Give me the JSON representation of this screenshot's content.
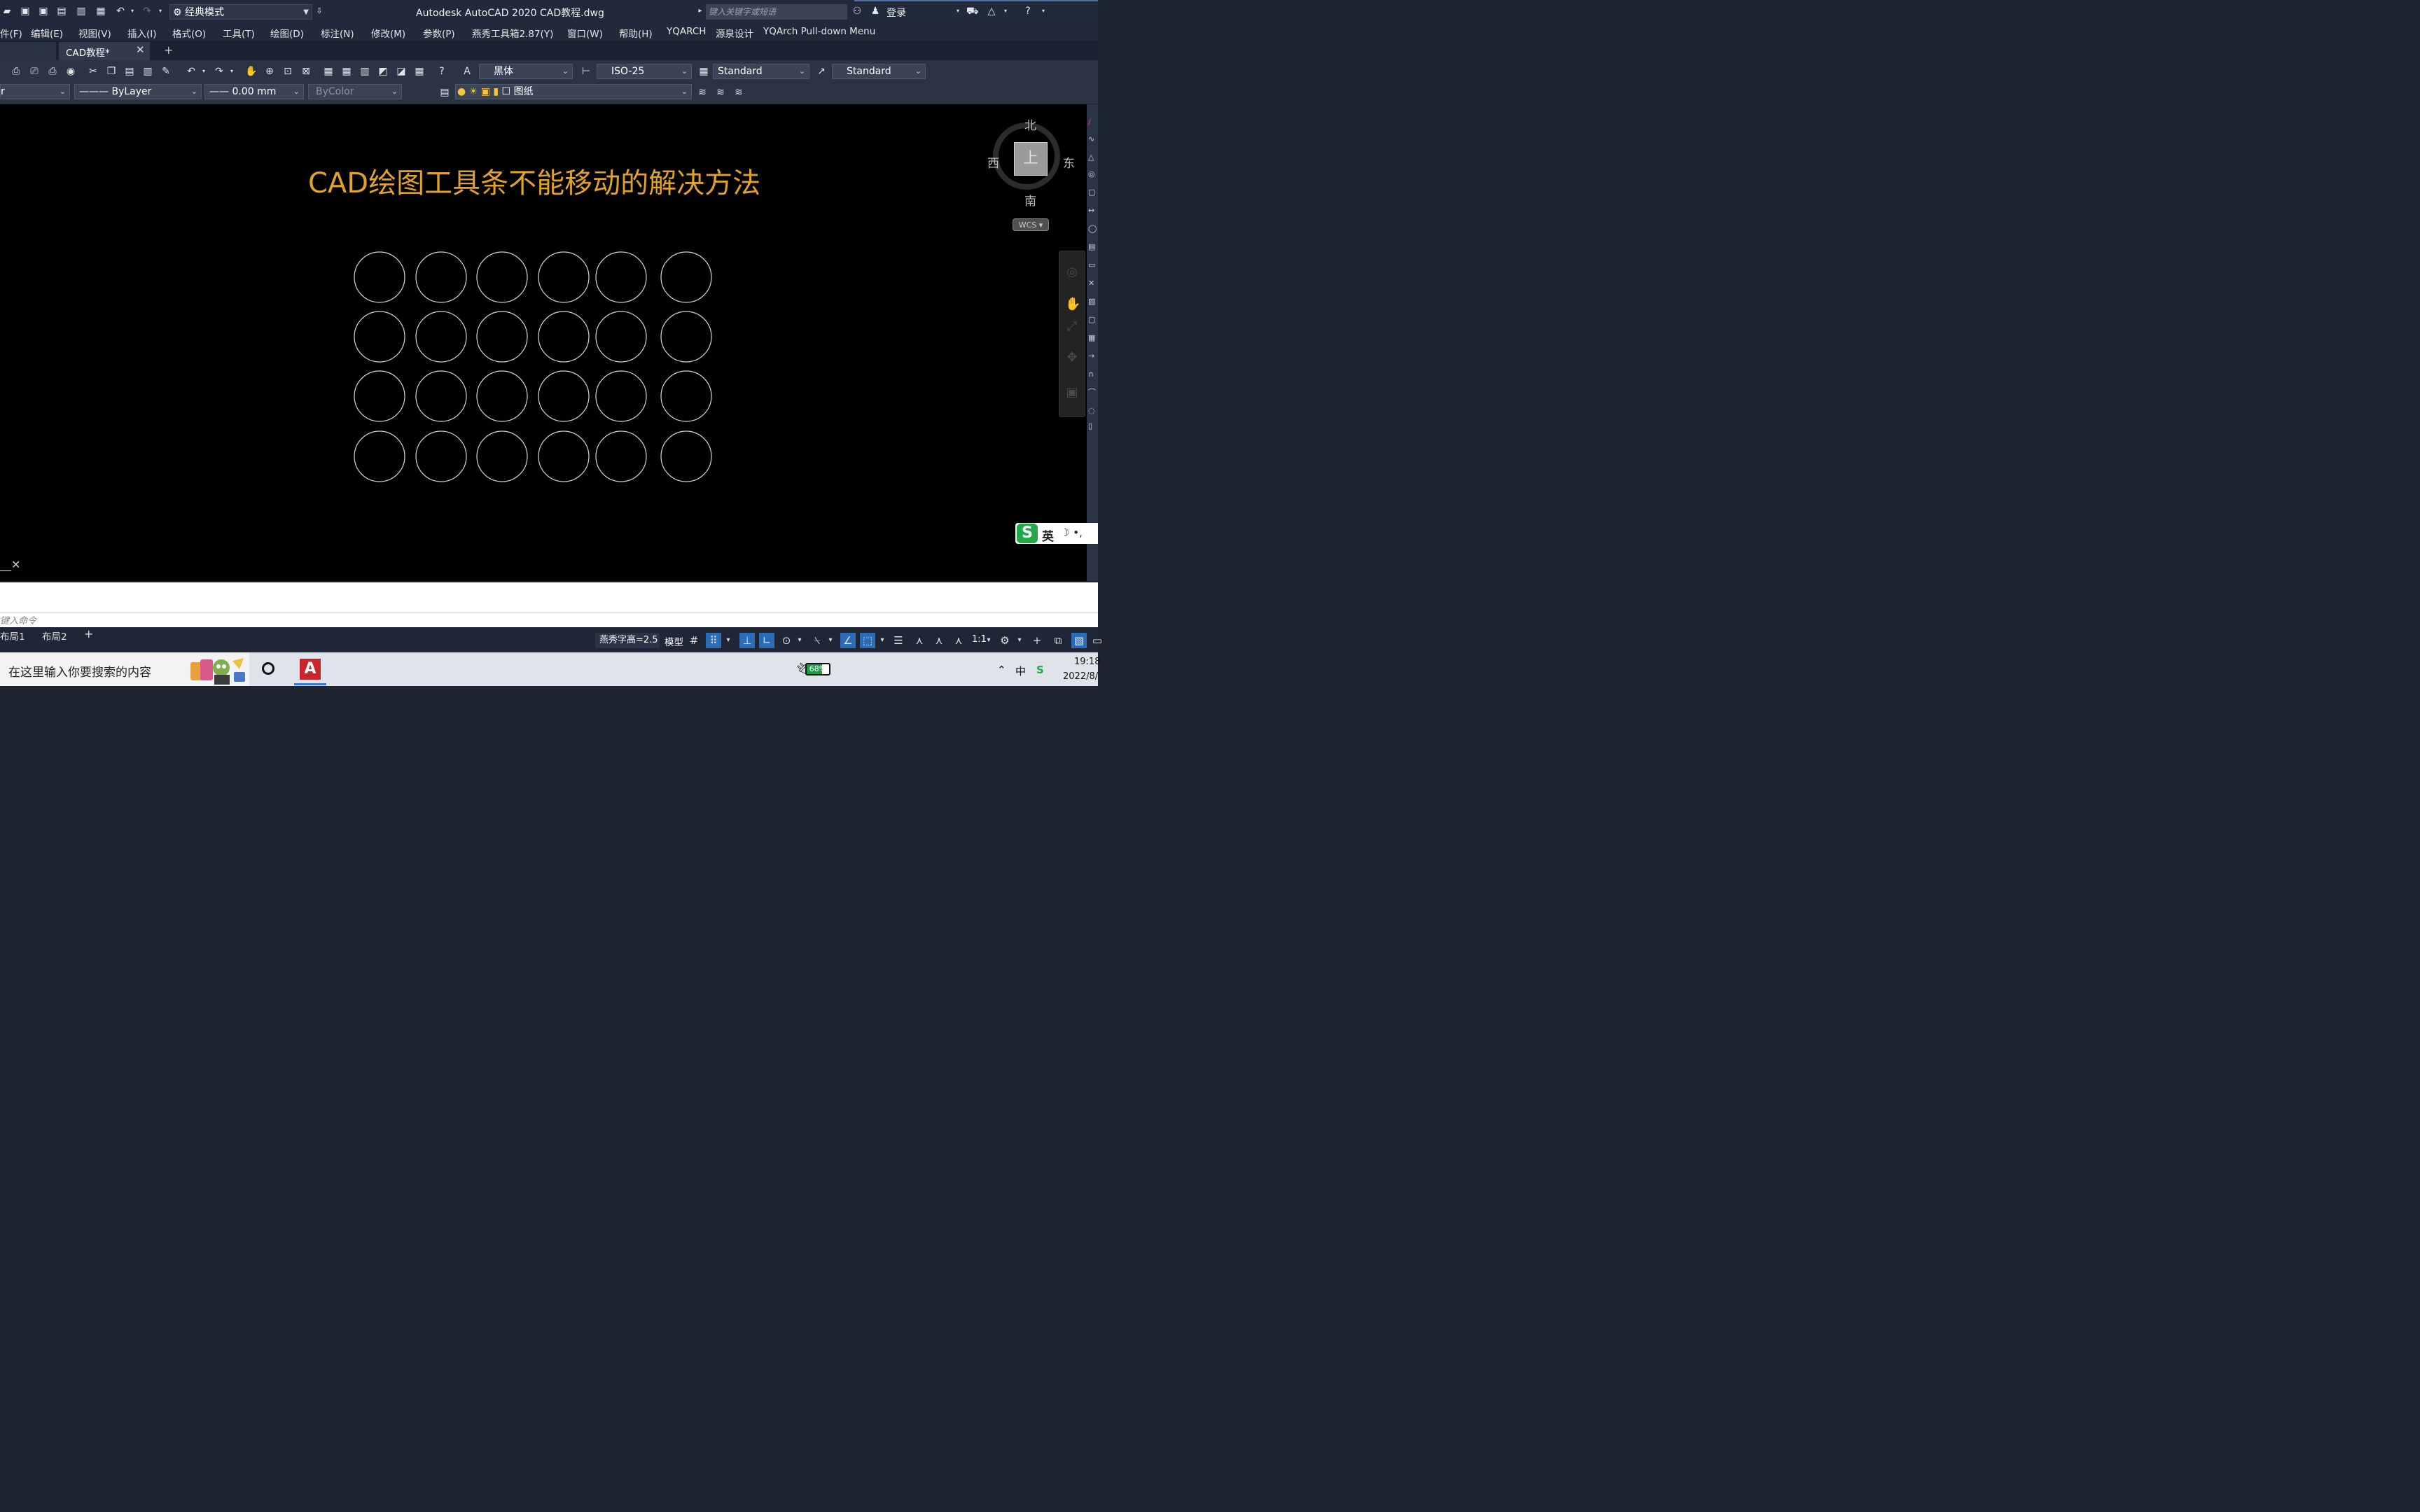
{
  "titlebar": {
    "workspace": "经典模式",
    "app_title": "Autodesk AutoCAD 2020    CAD教程.dwg",
    "search_placeholder": "键入关键字或短语",
    "login": "登录"
  },
  "menubar": {
    "items": [
      "件(F)",
      "编辑(E)",
      "视图(V)",
      "插入(I)",
      "格式(O)",
      "工具(T)",
      "绘图(D)",
      "标注(N)",
      "修改(M)",
      "参数(P)",
      "燕秀工具箱2.87(Y)",
      "窗口(W)",
      "帮助(H)",
      "YQARCH",
      "源泉设计",
      "YQArch Pull-down Menu"
    ]
  },
  "tabs": {
    "active_label": "CAD教程*",
    "close_glyph": "✕",
    "add_glyph": "+"
  },
  "toolbar1": {
    "text_style": "黑体",
    "dim_style": "ISO-25",
    "table_style": "Standard",
    "multileader_style": "Standard"
  },
  "toolbar2": {
    "layer_partial": "r",
    "linetype": "——— ByLayer",
    "lineweight": "—— 0.00 mm",
    "plot_style": "ByColor",
    "layer_name": "图纸"
  },
  "canvas": {
    "heading": "CAD绘图工具条不能移动的解决方法",
    "circle_grid": {
      "rows": 4,
      "cols": 6
    },
    "viewcube": {
      "north": "北",
      "south": "南",
      "east": "东",
      "west": "西",
      "face": "上",
      "wcs": "WCS"
    }
  },
  "ime": {
    "logo": "S",
    "lang": "英",
    "extra": "☽ •,"
  },
  "command": {
    "placeholder": "键入命令"
  },
  "statusbar": {
    "layouts": [
      "布局1",
      "布局2"
    ],
    "yanxiu_text": "燕秀字高=2.5",
    "model": "模型",
    "scale": "1:1"
  },
  "taskbar": {
    "search_text": "在这里输入你要搜索的内容",
    "battery": "68%",
    "ime_tray": "中",
    "time": "19:18",
    "date": "2022/8/"
  },
  "colors": {
    "heading": "#e0a22a",
    "canvas": "#000000",
    "chrome": "#2b3445",
    "status_active": "#2c6bb5"
  }
}
